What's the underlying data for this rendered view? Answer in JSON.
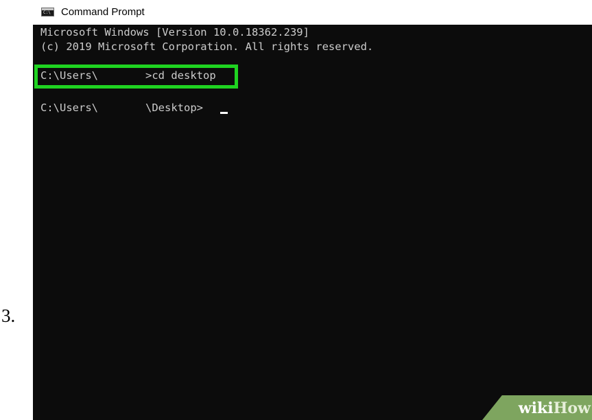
{
  "step": {
    "number": "3."
  },
  "window": {
    "title": "Command Prompt",
    "icon": "cmd-console-icon",
    "icon_glyph": "C:\\"
  },
  "console": {
    "header_line_1": "Microsoft Windows [Version 10.0.18362.239]",
    "header_line_2": "(c) 2019 Microsoft Corporation. All rights reserved.",
    "command_line": {
      "prompt": "C:\\Users\\",
      "command": ">cd desktop"
    },
    "result_line": {
      "prompt": "C:\\Users\\",
      "path": "\\Desktop>"
    },
    "highlight_color": "#1fd321",
    "background_color": "#0c0c0c",
    "text_color": "#cccccc"
  },
  "watermark": {
    "part_1": "wiki",
    "part_2": "How",
    "color": "#7ea55f"
  }
}
